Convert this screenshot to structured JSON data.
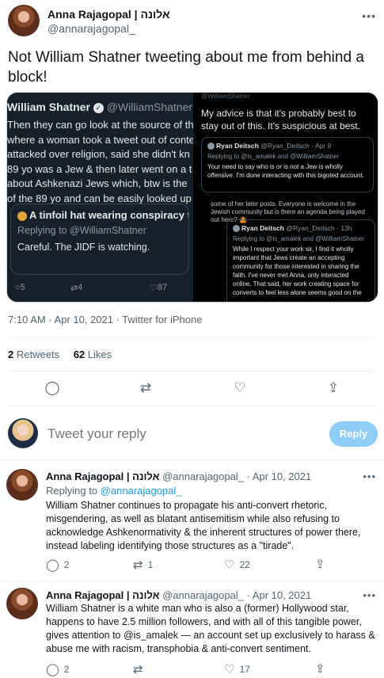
{
  "main": {
    "author_name": "Anna Rajagopal | אלונה",
    "author_handle": "@annarajagopal_",
    "text": "Not William Shatner tweeting about me from behind a block!",
    "timestamp": "7:10 AM · Apr 10, 2021 · Twitter for iPhone",
    "retweets_count": "2",
    "retweets_label": "Retweets",
    "likes_count": "62",
    "likes_label": "Likes"
  },
  "media": {
    "ws_name": "William Shatner",
    "ws_handle": "@WilliamShatner · 1",
    "ws_lines": [
      "Then they can go look at the source of th",
      "where a woman took a tweet out of conte",
      "attacked over religion, said she didn't kn",
      "89 yo was a Jew & then later went on a t",
      "about Ashkenazi Jews which, btw is the",
      "of the 89 yo and can be easily looked up"
    ],
    "quote_title": "A tinfoil hat wearing conspiracy t",
    "quote_replying": "Replying to @WilliamShatner",
    "quote_text": "Careful. The JIDF is watching.",
    "ws_replies": "5",
    "ws_retweets": "4",
    "ws_likes": "87",
    "rt_top": "@WilliamShatner",
    "rt_advice": "My advice is that it's probably best to stay out of this. It's suspicious at best.",
    "rt_card_name": "Ryan Deitsch",
    "rt_card_meta": "@Ryan_Deitsch · Apr 9",
    "rt_card_replying": "Replying to @is_amalek and @WilliamShatner",
    "rt_card_text": "Your need to say who is or is not a Jew is wholly offensive. I'm done interacting with this bigoted account.",
    "rb_top": "some of her later posts. Everyone is welcome in the Jewish community but is there an agenda being played out here? 🤷",
    "rb_card_name": "Ryan Deitsch",
    "rb_card_meta": "@Ryan_Deitsch · 13h",
    "rb_card_replying": "Replying to @is_amalek and @WilliamShatner",
    "rb_card_text": "While I respect your work sir, I find it wholly important that Jews create an accepting community for those interested in sharing the faith. I've never met Anna, only interacted online. That said, her work creating space for converts to feel less alone seems good on the"
  },
  "compose": {
    "placeholder": "Tweet your reply",
    "reply_button": "Reply"
  },
  "replies": [
    {
      "author_name": "Anna Rajagopal | אלונה",
      "author_meta": "@annarajagopal_ · Apr 10, 2021",
      "replying_prefix": "Replying to",
      "replying_handle": "@annarajagopal_",
      "text": "William Shatner continues to propagate his anti-convert rhetoric, misgendering, as well as blatant antisemitism while also refusing to acknowledge Ashkenormativity & the inherent structures of power there, instead labeling identifying those structures as a \"tirade\".",
      "reply_count": "2",
      "retweet_count": "1",
      "like_count": "22"
    },
    {
      "author_name": "Anna Rajagopal | אלונה",
      "author_meta": "@annarajagopal_ · Apr 10, 2021",
      "text": "William Shatner is a white man who is also a (former) Hollywood star, happens to have 2.5 million followers, and with all of this tangible power, gives attention to @is_amalek — an account set up exclusively to harass & abuse me with racism, transphobia & anti-convert sentiment.",
      "reply_count": "2",
      "retweet_count": "",
      "like_count": "17"
    }
  ],
  "icons": {
    "reply": "reply-icon",
    "retweet": "retweet-icon",
    "like": "heart-icon",
    "share": "share-icon",
    "more": "more-icon"
  },
  "colors": {
    "accent": "#1d9bf0",
    "reply_button": "#8ecdf8",
    "secondary_text": "#536471"
  }
}
